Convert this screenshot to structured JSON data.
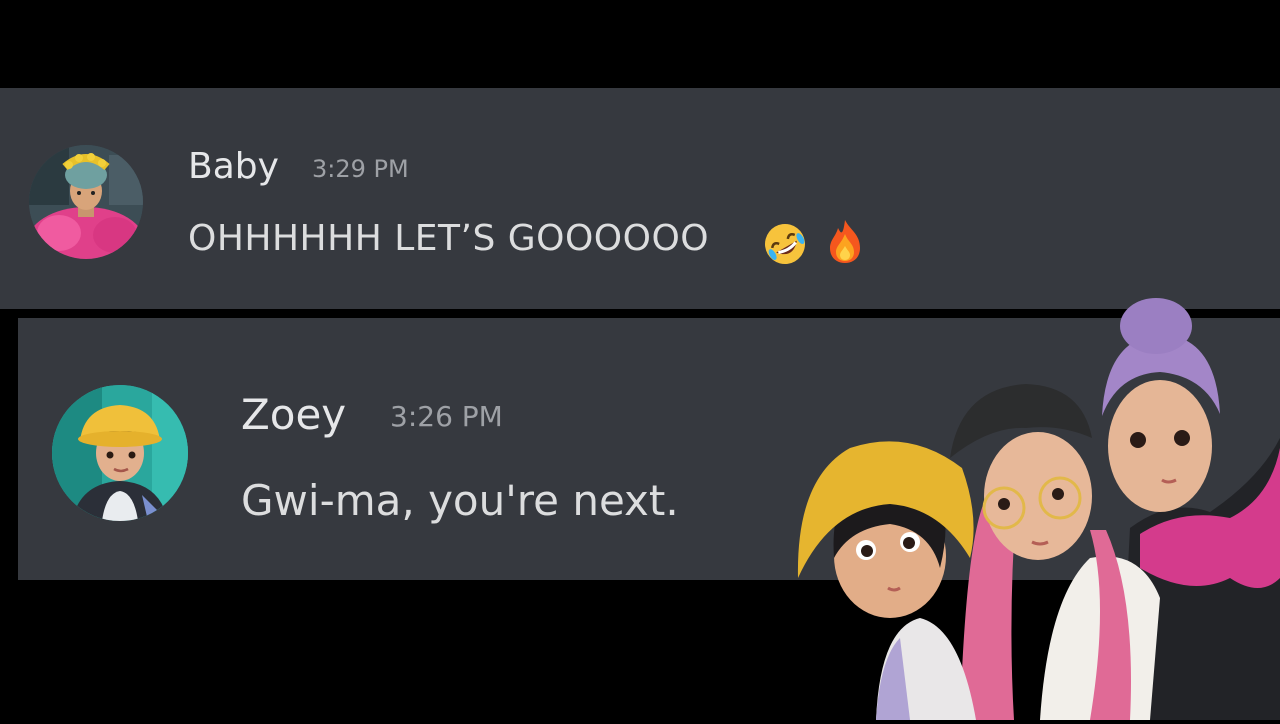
{
  "messages": [
    {
      "author": "Baby",
      "time": "3:29 PM",
      "text": "OHHHHHH LET’S GOOOOOO",
      "emojis": [
        "rolling-on-floor-laughing-icon",
        "fire-icon"
      ]
    },
    {
      "author": "Zoey",
      "time": "3:26 PM",
      "text": "Gwi-ma, you're next."
    }
  ],
  "colors": {
    "background": "#000000",
    "message_bg": "#36393f",
    "name": "#e6e7e9",
    "time": "#9ea1a6",
    "text": "#dcddde"
  }
}
